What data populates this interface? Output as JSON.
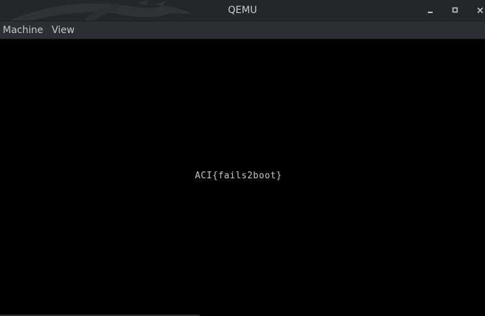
{
  "window": {
    "title": "QEMU"
  },
  "titlebar": {
    "background_art": "dragon-icon",
    "controls": {
      "minimize_icon": "minimize-icon",
      "maximize_icon": "maximize-icon",
      "close_icon": "close-icon"
    }
  },
  "menubar": {
    "items": [
      {
        "label": "Machine"
      },
      {
        "label": "View"
      }
    ]
  },
  "screen": {
    "console_text": "ACI{fails2boot}",
    "background": "#000000",
    "text_color": "#c8c8c8"
  }
}
